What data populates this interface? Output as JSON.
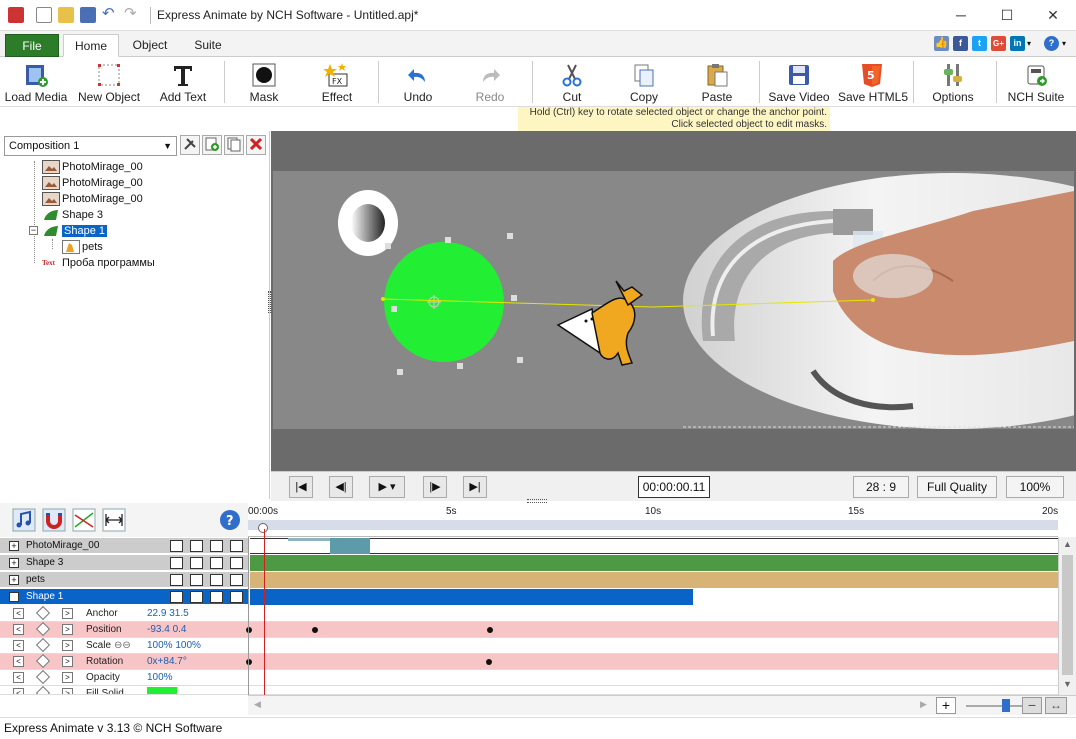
{
  "window": {
    "title": "Express Animate by NCH Software - Untitled.apj*",
    "minimize": "─",
    "maximize": "☐",
    "close": "✕"
  },
  "tabs": {
    "file": "File",
    "home": "Home",
    "object": "Object",
    "suite": "Suite"
  },
  "social": {
    "facebook": "f",
    "twitter": "t",
    "google": "G+",
    "linkedin": "in",
    "help": "?"
  },
  "toolbar": {
    "load_media": "Load Media",
    "new_object": "New Object",
    "add_text": "Add Text",
    "mask": "Mask",
    "effect": "Effect",
    "undo": "Undo",
    "redo": "Redo",
    "cut": "Cut",
    "copy": "Copy",
    "paste": "Paste",
    "save_video": "Save Video",
    "save_html5": "Save HTML5",
    "options": "Options",
    "nch_suite": "NCH Suite"
  },
  "hint": {
    "line1": "Hold (Ctrl) key to rotate selected object or change the anchor point.",
    "line2": "Click selected object to edit masks."
  },
  "left_panel": {
    "composition": "Composition 1",
    "tree": [
      {
        "label": "PhotoMirage_00",
        "icon": "photo-icon"
      },
      {
        "label": "PhotoMirage_00",
        "icon": "photo-icon"
      },
      {
        "label": "PhotoMirage_00",
        "icon": "photo-icon"
      },
      {
        "label": "Shape 3",
        "icon": "shape-icon"
      },
      {
        "label": "Shape 1",
        "icon": "shape-icon",
        "selected": true
      },
      {
        "label": "pets",
        "icon": "image-icon"
      },
      {
        "label": "Проба программы",
        "icon": "text-icon"
      }
    ],
    "text_icon_label": "Text"
  },
  "playback": {
    "timecode": "00:00:00.11",
    "aspect": "28 : 9",
    "quality": "Full Quality",
    "zoom": "100%"
  },
  "ruler": {
    "labels": [
      "00:00s",
      "5s",
      "10s",
      "15s",
      "20s"
    ]
  },
  "tracks": [
    {
      "name": "PhotoMirage_00",
      "toggle": "+"
    },
    {
      "name": "Shape 3",
      "toggle": "+"
    },
    {
      "name": "pets",
      "toggle": "+"
    },
    {
      "name": "Shape 1",
      "toggle": "−",
      "selected": true
    }
  ],
  "properties": [
    {
      "name": "Anchor",
      "value": "22.9  31.5"
    },
    {
      "name": "Position",
      "value": "-93.4  0.4"
    },
    {
      "name": "Scale",
      "value": "100%  100%"
    },
    {
      "name": "Rotation",
      "value": "0x+84.7°"
    },
    {
      "name": "Opacity",
      "value": "100%"
    },
    {
      "name": "Fill Solid",
      "value": ""
    }
  ],
  "colors": {
    "accent_green": "#2d7c2a",
    "select_blue": "#0a64c8",
    "track_shape3": "#4e9a44",
    "track_pets": "#d8b376",
    "track_photo": "#5d9bab",
    "keyframe_row": "#f7c5c5",
    "fill_solid": "#22ee33"
  },
  "status": "Express Animate v 3.13 © NCH Software"
}
